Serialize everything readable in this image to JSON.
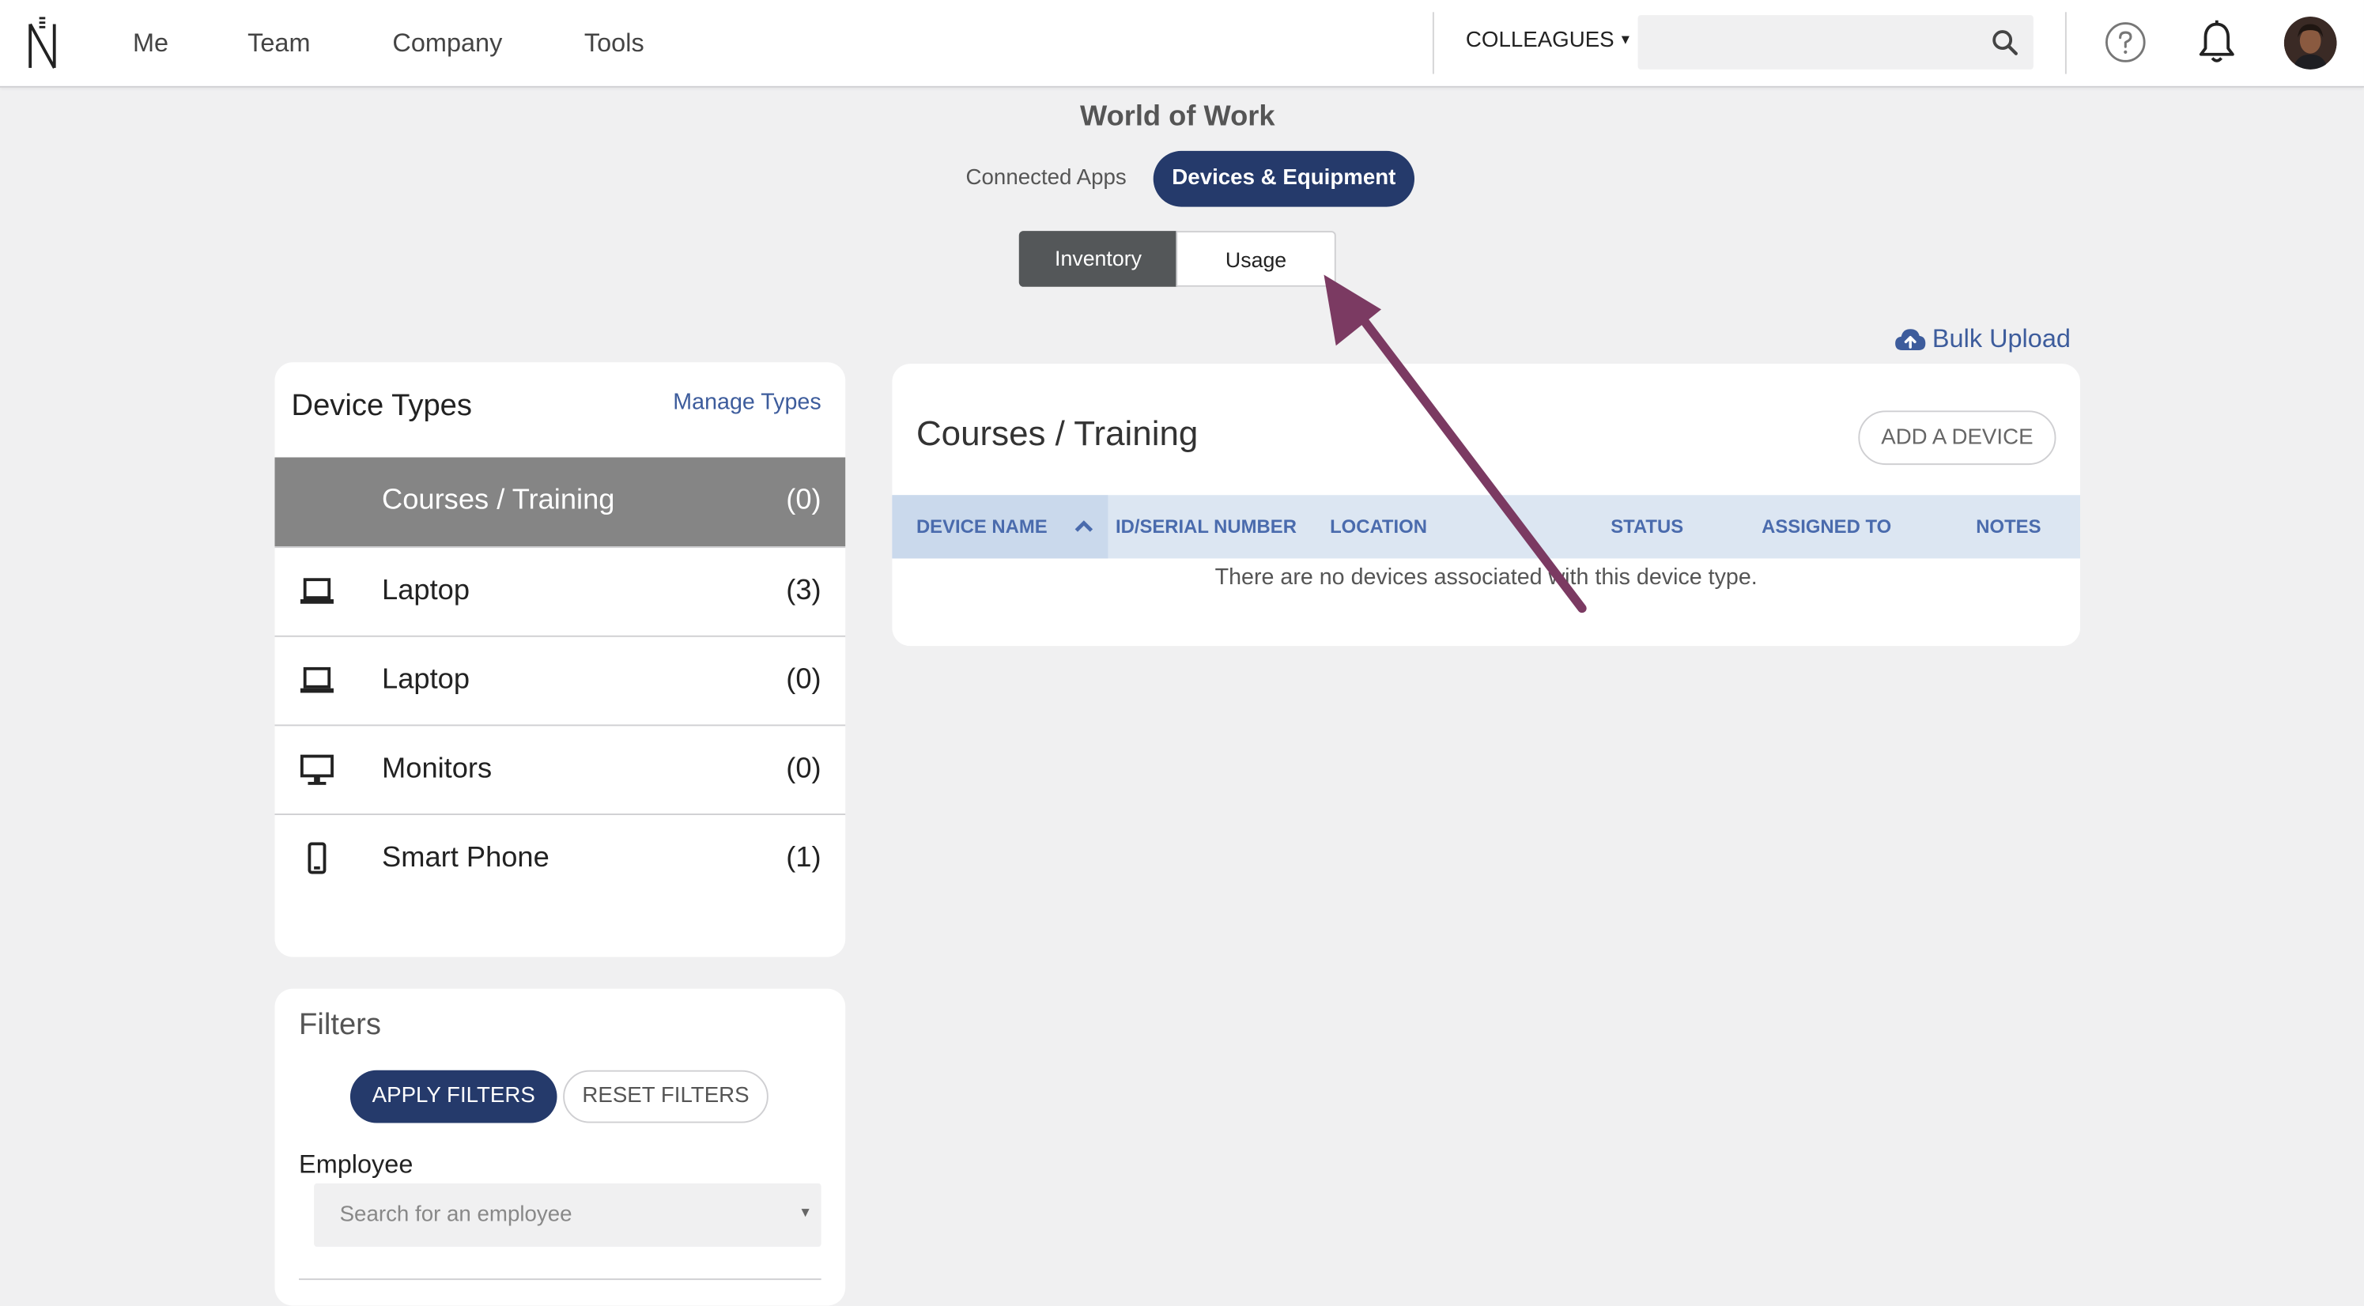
{
  "nav": {
    "items": [
      "Me",
      "Team",
      "Company",
      "Tools"
    ],
    "colleagues_label": "COLLEAGUES",
    "search": {
      "value": "",
      "placeholder": ""
    }
  },
  "page": {
    "title": "World of Work",
    "tabs": [
      {
        "label": "Connected Apps",
        "active": false
      },
      {
        "label": "Devices & Equipment",
        "active": true
      }
    ],
    "segments": [
      {
        "label": "Inventory",
        "active": true
      },
      {
        "label": "Usage",
        "active": false
      }
    ]
  },
  "device_types": {
    "title": "Device Types",
    "manage_label": "Manage Types",
    "items": [
      {
        "label": "Courses / Training",
        "count": "(0)",
        "icon": "none",
        "active": true
      },
      {
        "label": "Laptop",
        "count": "(3)",
        "icon": "laptop-icon",
        "active": false
      },
      {
        "label": "Laptop",
        "count": "(0)",
        "icon": "laptop-icon",
        "active": false
      },
      {
        "label": "Monitors",
        "count": "(0)",
        "icon": "monitor-icon",
        "active": false
      },
      {
        "label": "Smart Phone",
        "count": "(1)",
        "icon": "smartphone-icon",
        "active": false
      }
    ]
  },
  "filters": {
    "title": "Filters",
    "apply_label": "APPLY FILTERS",
    "reset_label": "RESET FILTERS",
    "employee_label": "Employee",
    "employee_placeholder": "Search for an employee"
  },
  "devices": {
    "bulk_upload_label": "Bulk Upload",
    "title": "Courses / Training",
    "add_label": "ADD A DEVICE",
    "columns": [
      "DEVICE NAME",
      "ID/SERIAL NUMBER",
      "LOCATION",
      "STATUS",
      "ASSIGNED TO",
      "NOTES"
    ],
    "sorted_column": "DEVICE NAME",
    "sort_direction": "ascending",
    "empty_message": "There are no devices associated with this device type."
  },
  "colors": {
    "primary": "#253a6b",
    "link": "#3d5c9c",
    "header_row": "#dce6f2",
    "active_row": "#858585",
    "annotation_arrow": "#7b3a62"
  }
}
